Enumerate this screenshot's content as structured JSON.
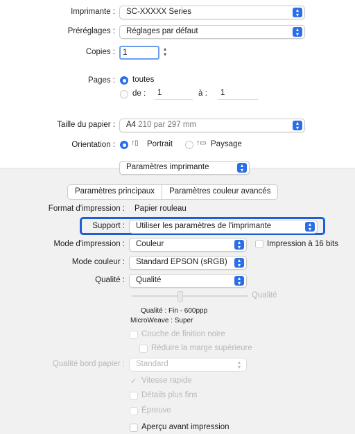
{
  "printer": {
    "label": "Imprimante :",
    "value": "SC-XXXXX Series"
  },
  "presets": {
    "label": "Préréglages :",
    "value": "Réglages par défaut"
  },
  "copies": {
    "label": "Copies :",
    "value": "1"
  },
  "pages": {
    "label": "Pages :",
    "all": "toutes",
    "from": "de :",
    "from_value": "1",
    "to": "à :",
    "to_value": "1"
  },
  "paper": {
    "label": "Taille du papier :",
    "size": "A4",
    "dimensions": "210 par 297 mm"
  },
  "orientation": {
    "label": "Orientation :",
    "portrait": "Portrait",
    "landscape": "Paysage"
  },
  "section": {
    "value": "Paramètres imprimante"
  },
  "tabs": [
    {
      "label": "Paramètres principaux"
    },
    {
      "label": "Paramètres couleur avancés"
    }
  ],
  "settings": {
    "format": {
      "label": "Format d'impression :",
      "value": "Papier rouleau"
    },
    "support": {
      "label": "Support :",
      "value": "Utiliser les paramètres de l'imprimante"
    },
    "mode_print": {
      "label": "Mode d'impression :",
      "value": "Couleur"
    },
    "bits16": "Impression à 16 bits",
    "mode_color": {
      "label": "Mode couleur :",
      "value": "Standard EPSON (sRGB)"
    },
    "quality": {
      "label": "Qualité :",
      "value": "Qualité"
    },
    "quality_slider_label": "Qualité",
    "quality_detail": "Qualité : Fin - 600ppp",
    "microweave": "MicroWeave : Super",
    "finish_layer": "Couche de finition noire",
    "reduce_margin": "Réduire la marge supérieure",
    "edge_quality": {
      "label": "Qualité bord papier :",
      "value": "Standard"
    },
    "speed": "Vitesse rapide",
    "finer": "Détails plus fins",
    "proof": "Épreuve",
    "preview": "Aperçu avant impression"
  },
  "colors": {
    "accent": "#2a6ee8",
    "highlight_border": "#1d5fd6"
  }
}
